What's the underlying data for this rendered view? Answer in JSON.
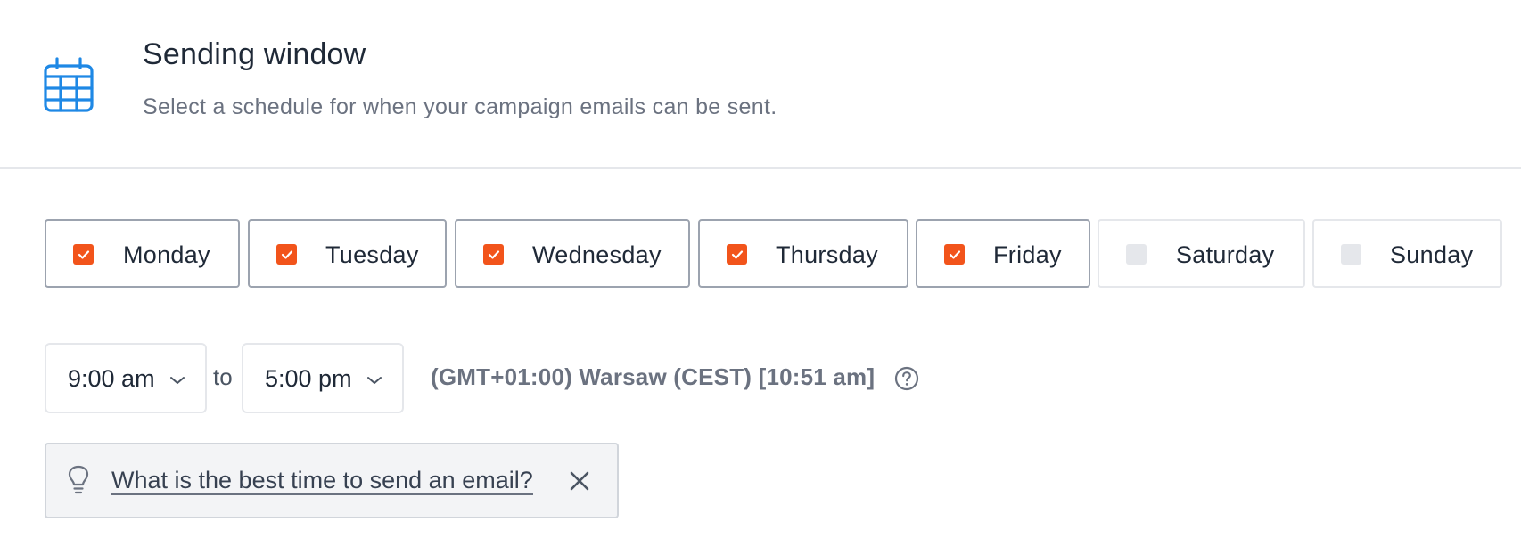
{
  "header": {
    "icon": "calendar-icon",
    "title": "Sending window",
    "subtitle": "Select a schedule for when your campaign emails can be sent."
  },
  "colors": {
    "accent": "#f2541b",
    "icon_blue": "#1e88e5"
  },
  "days": [
    {
      "label": "Monday",
      "checked": true
    },
    {
      "label": "Tuesday",
      "checked": true
    },
    {
      "label": "Wednesday",
      "checked": true
    },
    {
      "label": "Thursday",
      "checked": true
    },
    {
      "label": "Friday",
      "checked": true
    },
    {
      "label": "Saturday",
      "checked": false
    },
    {
      "label": "Sunday",
      "checked": false
    }
  ],
  "schedule": {
    "start_time": "9:00 am",
    "separator": "to",
    "end_time": "5:00 pm",
    "timezone": "(GMT+01:00) Warsaw (CEST) [10:51 am]"
  },
  "tip": {
    "text": "What is the best time to send an email?"
  }
}
